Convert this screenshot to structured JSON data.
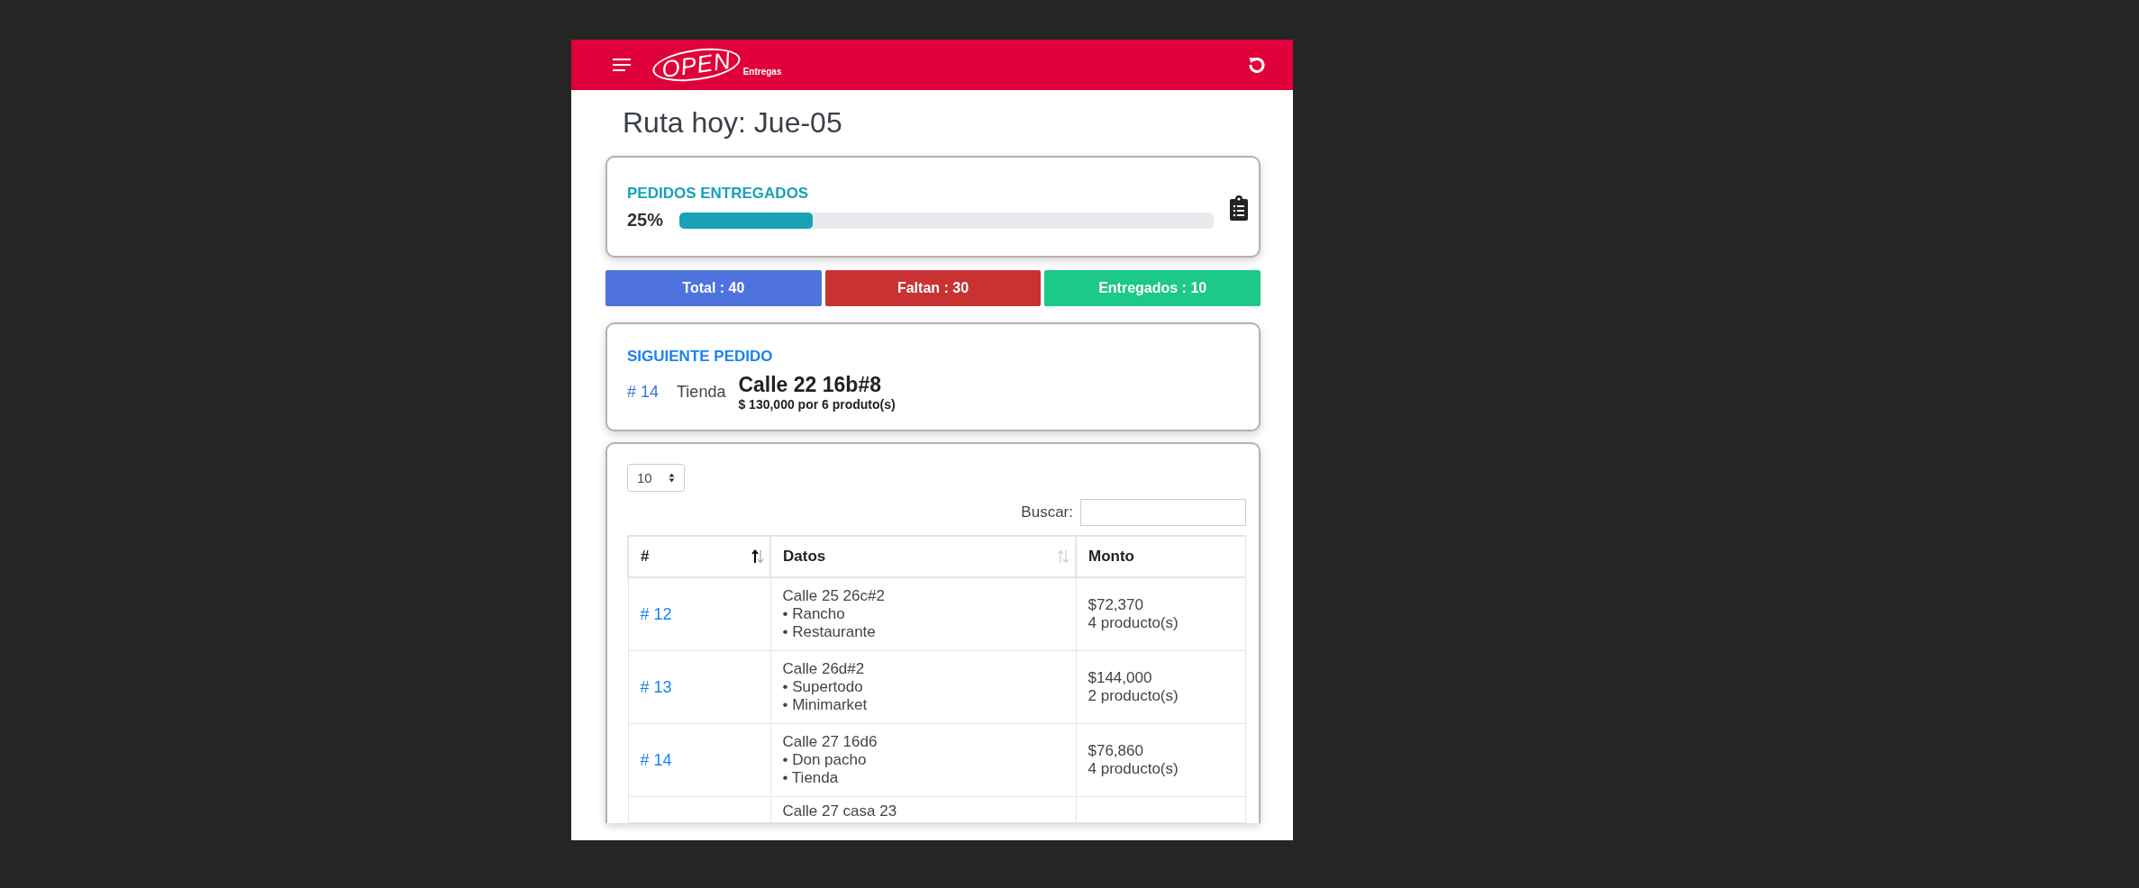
{
  "app_bar": {
    "logo": "OPEN",
    "logo_subtitle": "Entregas"
  },
  "page_title": "Ruta hoy: Jue-05",
  "progress_card": {
    "title": "PEDIDOS ENTREGADOS",
    "percent": "25%",
    "level": 0.25
  },
  "stats": [
    {
      "label": "Total : 40",
      "color": "#4e73df"
    },
    {
      "label": "Faltan : 30",
      "color": "#c93232"
    },
    {
      "label": "Entregados : 10",
      "color": "#1cc88a"
    }
  ],
  "next_order": {
    "title": "SIGUIENTE PEDIDO",
    "number": "# 14",
    "store": "Tienda",
    "address": "Calle 22 16b#8",
    "summary": "$ 130,000 por 6 produto(s)"
  },
  "table": {
    "page_size": "10",
    "search_label": "Buscar:",
    "columns": [
      {
        "label": "#",
        "sortable": true,
        "sorted": true
      },
      {
        "label": "Datos",
        "sortable": true,
        "sorted": false
      },
      {
        "label": "Monto"
      }
    ],
    "rows": [
      {
        "number": "# 12",
        "address": "Calle 25 26c#2",
        "tags": [
          "• Rancho",
          "• Restaurante"
        ],
        "amount": "$72,370",
        "products": "4 producto(s)"
      },
      {
        "number": "# 13",
        "address": "Calle 26d#2",
        "tags": [
          "• Supertodo",
          "• Minimarket"
        ],
        "amount": "$144,000",
        "products": "2 producto(s)"
      },
      {
        "number": "# 14",
        "address": "Calle 27 16d6",
        "tags": [
          "• Don pacho",
          "• Tienda"
        ],
        "amount": "$76,860",
        "products": "4 producto(s)"
      },
      {
        "address": "Calle 27 casa 23"
      }
    ]
  }
}
